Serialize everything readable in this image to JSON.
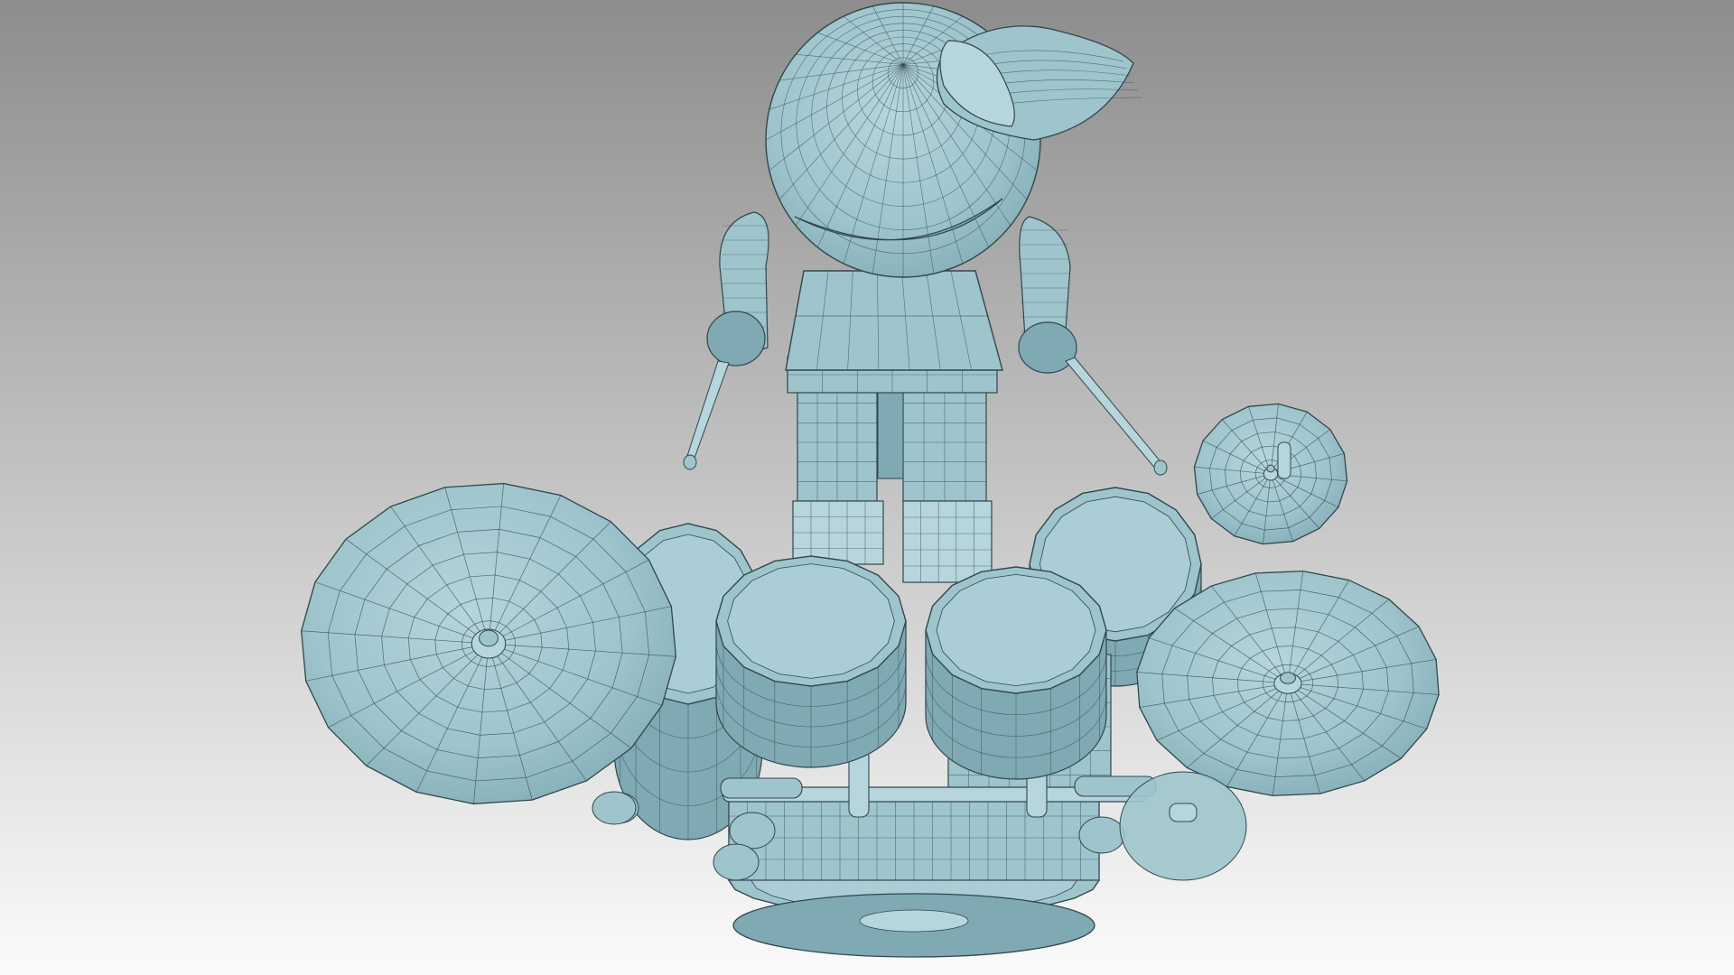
{
  "viewport": {
    "background": {
      "top_color": "#8d8d8d",
      "bottom_color": "#fbfbfb"
    },
    "model": {
      "subject": "cartoon-character-drummer-with-drum-kit",
      "render_style": "wireframe-over-shaded",
      "fill_color": "#9ec4cc",
      "fill_shadow_color": "#7fa9b3",
      "fill_highlight_color": "#b6d5dc",
      "wire_color": "#31474d"
    }
  }
}
